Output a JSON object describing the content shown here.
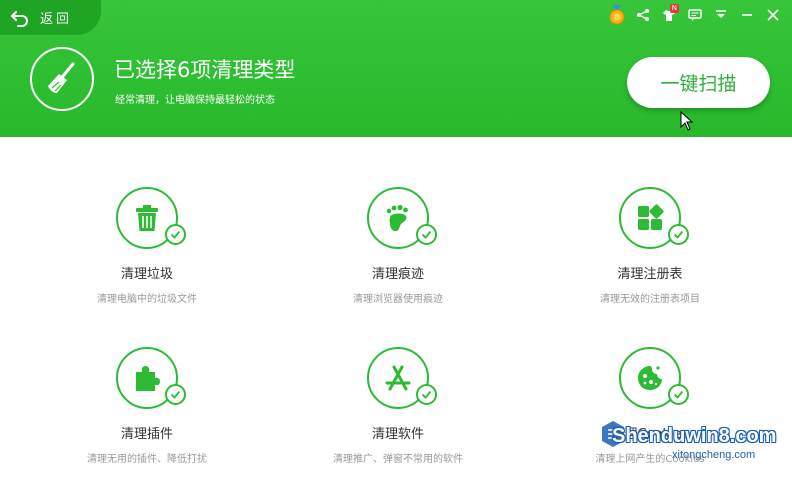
{
  "header": {
    "back_label": "返回",
    "title": "已选择6项清理类型",
    "subtitle": "经常清理，让电脑保持最轻松的状态",
    "scan_button": "一键扫描",
    "notice_badge": "N"
  },
  "colors": {
    "brand_green": "#2dbb35",
    "header_green": "#32c035",
    "back_green": "#1fa524"
  },
  "items": [
    {
      "title": "清理垃圾",
      "desc": "清理电脑中的垃圾文件",
      "icon": "trash-icon",
      "checked": true
    },
    {
      "title": "清理痕迹",
      "desc": "清理浏览器使用痕迹",
      "icon": "footprint-icon",
      "checked": true
    },
    {
      "title": "清理注册表",
      "desc": "清理无效的注册表项目",
      "icon": "registry-blocks-icon",
      "checked": true
    },
    {
      "title": "清理插件",
      "desc": "清理无用的插件、降低打扰",
      "icon": "puzzle-icon",
      "checked": true
    },
    {
      "title": "清理软件",
      "desc": "清理推广、弹窗不常用的软件",
      "icon": "app-store-icon",
      "checked": true
    },
    {
      "title": "清理Cookies",
      "desc": "清理上网产生的Cookies",
      "icon": "cookie-icon",
      "checked": true
    }
  ],
  "watermark": {
    "main": "Shenduwin8.com",
    "sub": "xitongcheng.com"
  }
}
